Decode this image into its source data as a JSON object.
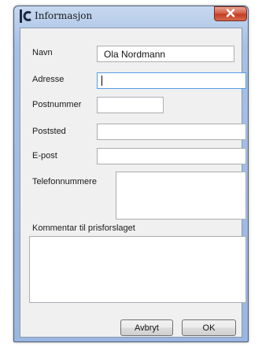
{
  "window": {
    "title": "Informasjon",
    "app_icon_text": "IC"
  },
  "fields": {
    "navn": {
      "label": "Navn",
      "value": "Ola Nordmann"
    },
    "adresse": {
      "label": "Adresse",
      "value": ""
    },
    "postnummer": {
      "label": "Postnummer",
      "value": ""
    },
    "poststed": {
      "label": "Poststed",
      "value": ""
    },
    "epost": {
      "label": "E-post",
      "value": ""
    },
    "telefon": {
      "label": "Telefonnummere",
      "value": ""
    },
    "kommentar": {
      "label": "Kommentar til prisforslaget",
      "value": ""
    }
  },
  "buttons": {
    "cancel_label": "Avbryt",
    "ok_label": "OK"
  },
  "icons": {
    "app": "ic-logo-icon",
    "close": "close-icon"
  },
  "colors": {
    "close_button": "#c8432a",
    "focus_border": "#569de5",
    "dialog_bg": "#f0f0f0"
  }
}
